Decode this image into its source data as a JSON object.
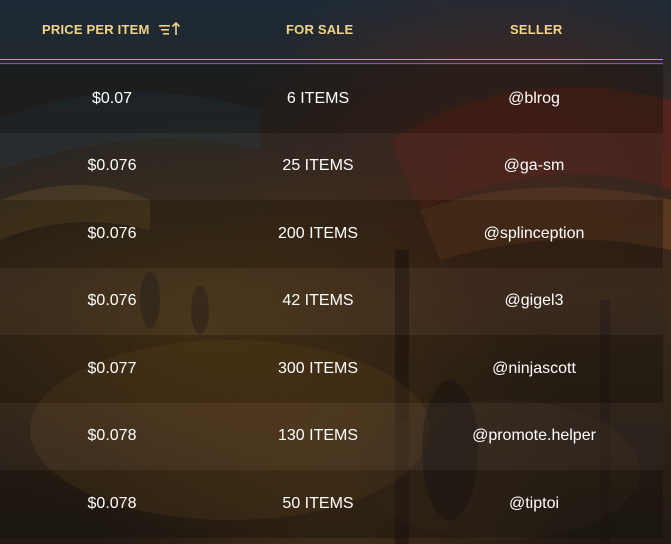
{
  "header": {
    "price_label": "PRICE PER ITEM",
    "sale_label": "FOR SALE",
    "seller_label": "SELLER",
    "sort_icon": "sort-ascending-icon"
  },
  "colors": {
    "header_text": "#f1d48a",
    "divider": "#c8a654",
    "row_text": "#ffffff"
  },
  "rows": [
    {
      "price": "$0.07",
      "for_sale": "6 ITEMS",
      "seller": "@blrog"
    },
    {
      "price": "$0.076",
      "for_sale": "25 ITEMS",
      "seller": "@ga-sm"
    },
    {
      "price": "$0.076",
      "for_sale": "200 ITEMS",
      "seller": "@splinception"
    },
    {
      "price": "$0.076",
      "for_sale": "42 ITEMS",
      "seller": "@gigel3"
    },
    {
      "price": "$0.077",
      "for_sale": "300 ITEMS",
      "seller": "@ninjascott"
    },
    {
      "price": "$0.078",
      "for_sale": "130 ITEMS",
      "seller": "@promote.helper"
    },
    {
      "price": "$0.078",
      "for_sale": "50 ITEMS",
      "seller": "@tiptoi"
    }
  ]
}
